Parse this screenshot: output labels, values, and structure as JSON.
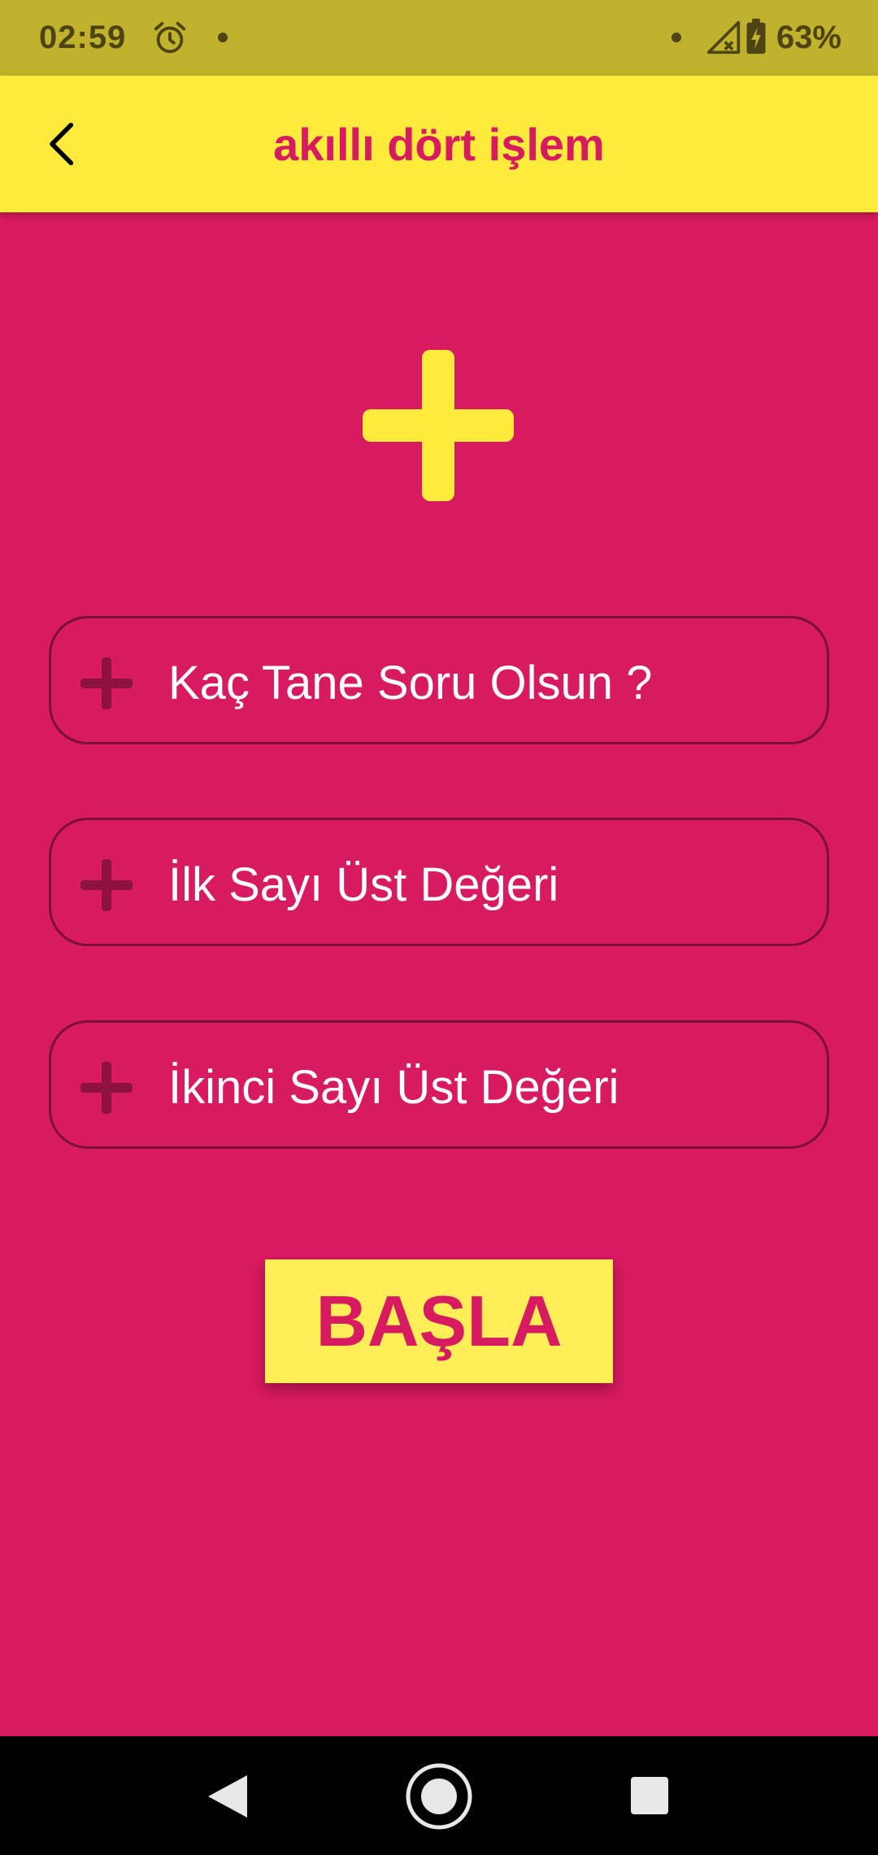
{
  "status_bar": {
    "time": "02:59",
    "battery": "63%",
    "icons": [
      "alarm-icon",
      "dot-icon",
      "dot-icon",
      "signal-icon",
      "battery-charging-icon"
    ]
  },
  "app_bar": {
    "title": "akıllı dört işlem",
    "back_icon": "back-arrow-icon"
  },
  "operation": {
    "icon": "plus-icon",
    "color": "#FFEB3B"
  },
  "fields": [
    {
      "icon": "plus-icon",
      "label": "Kaç Tane Soru Olsun ?"
    },
    {
      "icon": "plus-icon",
      "label": "İlk Sayı Üst Değeri"
    },
    {
      "icon": "plus-icon",
      "label": "İkinci Sayı Üst Değeri"
    }
  ],
  "start_button": {
    "label": "BAŞLA"
  },
  "nav_bar": {
    "icons": [
      "nav-back-icon",
      "nav-home-icon",
      "nav-recents-icon"
    ]
  },
  "colors": {
    "background": "#D81B60",
    "app_bar": "#FFEB3B",
    "status_bar": "#C0B22C",
    "accent_text": "#D81B60",
    "field_border": "#7A1035",
    "field_icon": "#8E1240",
    "nav_bar": "#000000"
  }
}
